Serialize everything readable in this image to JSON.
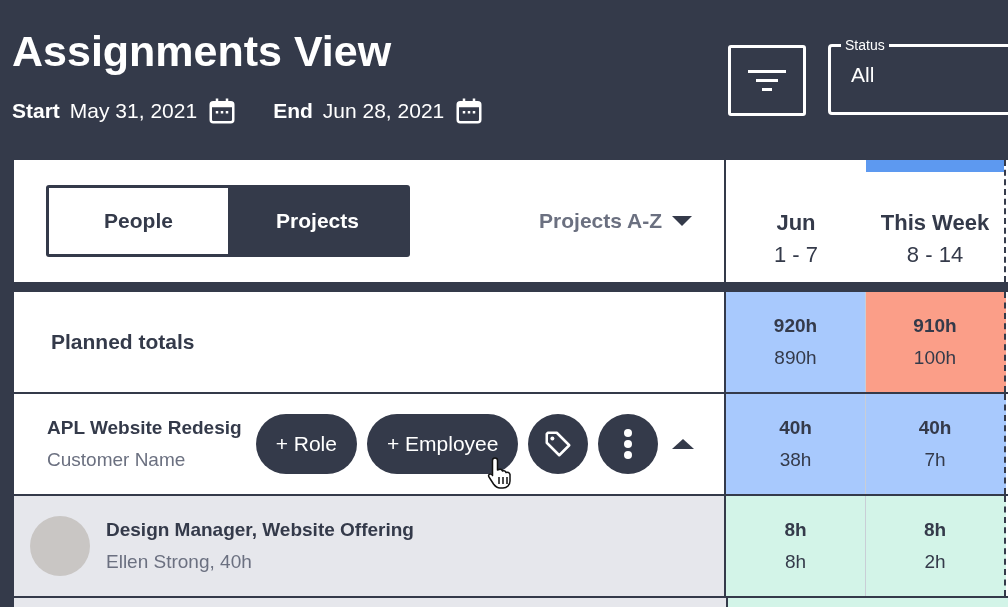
{
  "header": {
    "title": "Assignments View",
    "start_label": "Start",
    "start_date": "May 31, 2021",
    "end_label": "End",
    "end_date": "Jun 28, 2021"
  },
  "status_field": {
    "label": "Status",
    "value": "All"
  },
  "view_toggle": [
    {
      "label": "People",
      "selected": false
    },
    {
      "label": "Projects",
      "selected": true
    }
  ],
  "sort": {
    "label": "Projects A-Z"
  },
  "weeks": [
    {
      "label": "Jun",
      "range": "1 - 7",
      "current": false
    },
    {
      "label": "This Week",
      "range": "8 - 14",
      "current": true
    }
  ],
  "rows": [
    {
      "kind": "totals",
      "title": "Planned totals",
      "cells": [
        {
          "planned": "920h",
          "actual": "890h",
          "color": "#a8c9fd"
        },
        {
          "planned": "910h",
          "actual": "100h",
          "color": "#fb9e88"
        }
      ]
    },
    {
      "kind": "project",
      "title": "APL Website Redesig",
      "subtitle": "Customer Name",
      "expanded": true,
      "actions": [
        "+ Role",
        "+ Employee"
      ],
      "cells": [
        {
          "planned": "40h",
          "actual": "38h",
          "color": "#a8c9fd"
        },
        {
          "planned": "40h",
          "actual": "7h",
          "color": "#a8c9fd"
        }
      ]
    },
    {
      "kind": "assignment",
      "title": "Design Manager, Website Offering",
      "subtitle": "Ellen Strong, 40h",
      "cells": [
        {
          "planned": "8h",
          "actual": "8h",
          "color": "#d3f4e8"
        },
        {
          "planned": "8h",
          "actual": "2h",
          "color": "#d3f4e8"
        }
      ]
    }
  ]
}
